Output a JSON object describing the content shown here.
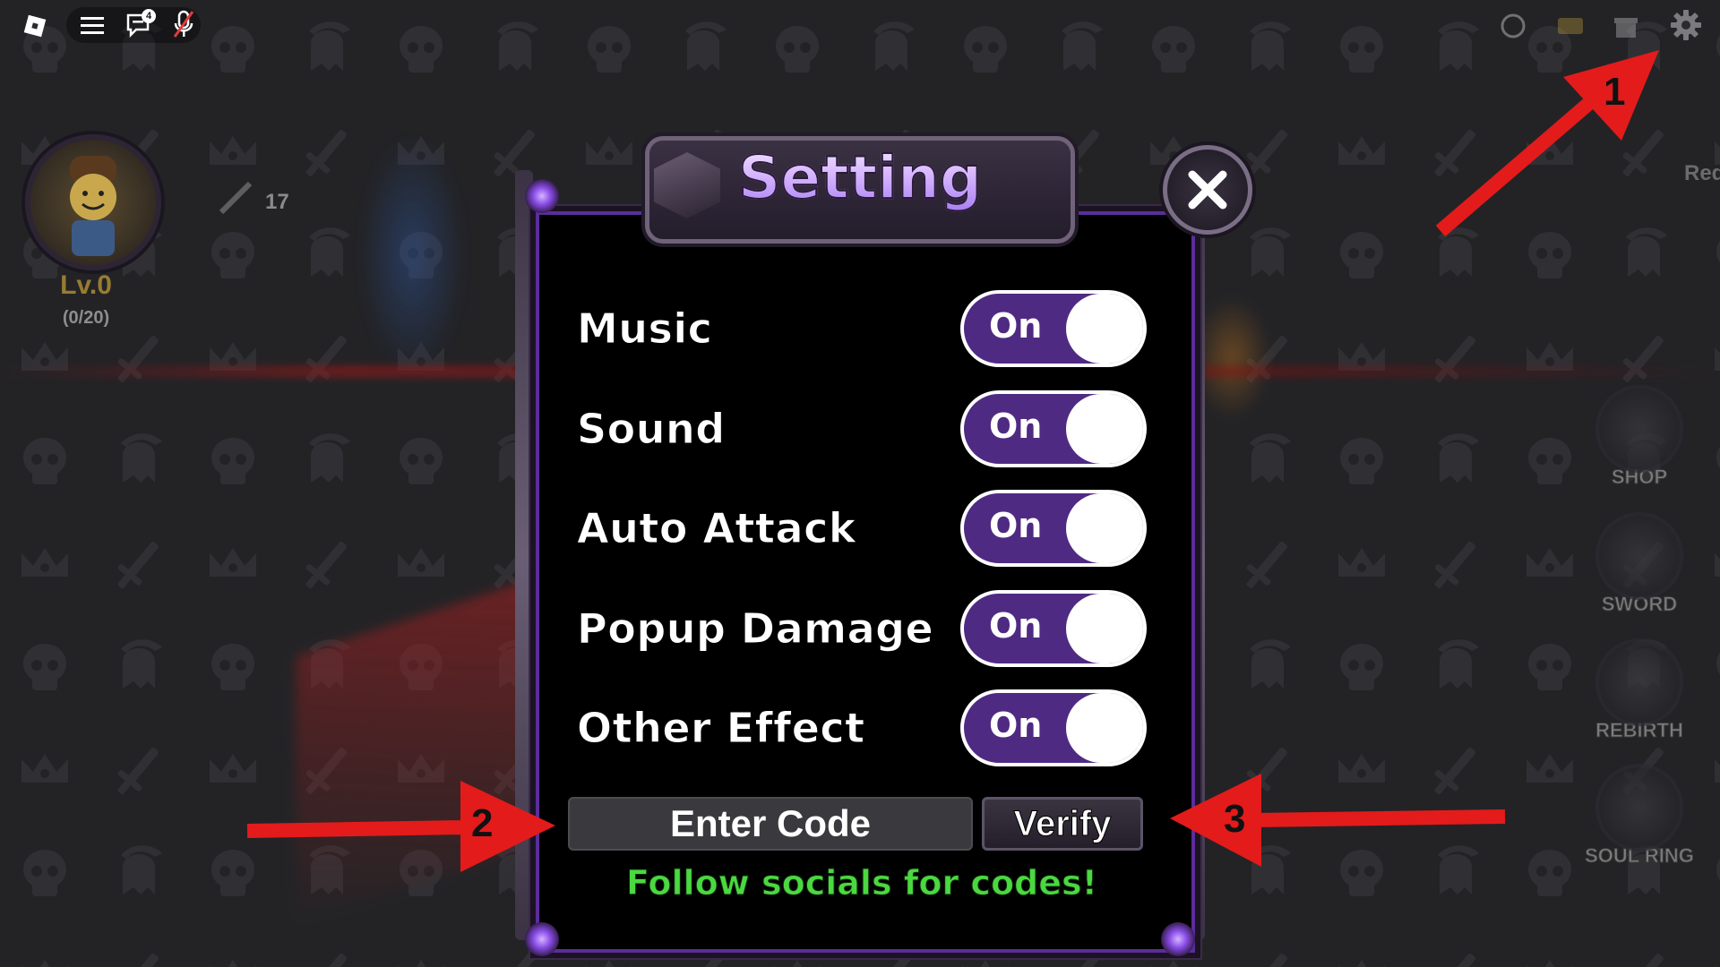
{
  "topbar": {
    "chat_badge": "4",
    "icons": [
      "roblox-logo-icon",
      "menu-icon",
      "chat-icon",
      "mic-muted-icon"
    ],
    "right_icons": [
      "emote-icon",
      "profile-card-icon",
      "gift-icon",
      "gear-icon"
    ]
  },
  "hud": {
    "level": "Lv.0",
    "xp": "(0/20)",
    "sword_count": "17",
    "reduce_label": "Reduc",
    "side_buttons": [
      "SHOP",
      "SWORD",
      "REBIRTH",
      "SOUL RING"
    ]
  },
  "modal": {
    "title": "Setting",
    "settings": [
      {
        "label": "Music",
        "state": "On"
      },
      {
        "label": "Sound",
        "state": "On"
      },
      {
        "label": "Auto Attack",
        "state": "On"
      },
      {
        "label": "Popup Damage",
        "state": "On"
      },
      {
        "label": "Other Effect",
        "state": "On"
      }
    ],
    "code_placeholder": "Enter Code",
    "verify_label": "Verify",
    "socials_text": "Follow socials for codes!"
  },
  "annotations": {
    "marker_1": "1",
    "marker_2": "2",
    "marker_3": "3"
  },
  "colors": {
    "toggle_on": "#4f2a82",
    "accent_purple": "#a77ff0",
    "socials_green": "#4bd840",
    "arrow_red": "#e31b1b"
  }
}
